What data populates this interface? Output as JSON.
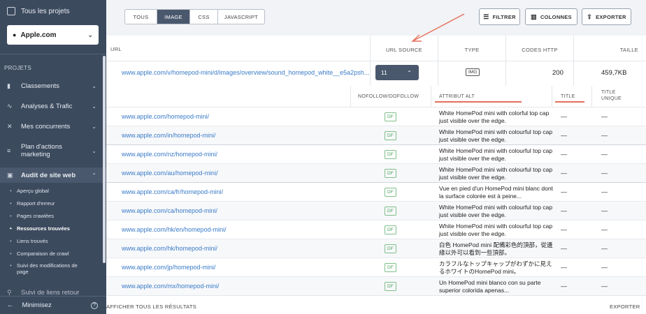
{
  "sidebar": {
    "all_projects": "Tous les projets",
    "site": "Apple.com",
    "section": "PROJETS",
    "items": [
      {
        "label": "Classements",
        "icon": "bar-chart-icon"
      },
      {
        "label": "Analyses & Trafic",
        "icon": "pulse-icon"
      },
      {
        "label": "Mes concurrents",
        "icon": "swords-icon"
      },
      {
        "label": "Plan d'actions marketing",
        "icon": "checklist-icon"
      },
      {
        "label": "Audit de site web",
        "icon": "audit-icon"
      }
    ],
    "subitems": [
      {
        "label": "Aperçu global"
      },
      {
        "label": "Rapport d'erreur"
      },
      {
        "label": "Pages crawlées"
      },
      {
        "label": "Ressources trouvées"
      },
      {
        "label": "Liens trouvés"
      },
      {
        "label": "Comparaison de crawl"
      },
      {
        "label": "Suivi des modifications de page"
      }
    ],
    "partial_item": "Suivi de liens retour",
    "minimize": "Minimisez"
  },
  "filters": {
    "tabs": [
      "TOUS",
      "IMAGE",
      "CSS",
      "JAVASCRIPT"
    ],
    "active": "IMAGE"
  },
  "toolbar": {
    "filter": "FILTRER",
    "columns": "COLONNES",
    "export": "EXPORTER"
  },
  "resources": {
    "headers": {
      "url": "URL",
      "source": "URL SOURCE",
      "type": "TYPE",
      "http": "CODES HTTP",
      "size": "TAILLE"
    },
    "row": {
      "url": "www.apple.com/v/homepod-mini/d/images/overview/sound_homepod_white__e5a2psh...",
      "source_count": "11",
      "type": "IMG",
      "http": "200",
      "size": "459,7KB"
    }
  },
  "sources": {
    "headers": {
      "nofollow": "NOFOLLOW/DOFOLLOW",
      "alt": "ATTRIBUT ALT",
      "title": "TITLE",
      "unique": "TITLE UNIQUE"
    },
    "rows": [
      {
        "url": "www.apple.com/homepod-mini/",
        "follow": "DF",
        "alt": "White HomePod mini with colorful top cap just visible over the edge.",
        "title": "—",
        "unique": "—"
      },
      {
        "url": "www.apple.com/in/homepod-mini/",
        "follow": "DF",
        "alt": "White HomePod mini with colourful top cap just visible over the edge.",
        "title": "—",
        "unique": "—"
      },
      {
        "url": "www.apple.com/nz/homepod-mini/",
        "follow": "DF",
        "alt": "White HomePod mini with colourful top cap just visible over the edge.",
        "title": "—",
        "unique": "—"
      },
      {
        "url": "www.apple.com/au/homepod-mini/",
        "follow": "DF",
        "alt": "White HomePod mini with colourful top cap just visible over the edge.",
        "title": "—",
        "unique": "—"
      },
      {
        "url": "www.apple.com/ca/fr/homepod-mini/",
        "follow": "DF",
        "alt": "Vue en pied d'un HomePod mini blanc dont la surface colorée est à peine...",
        "title": "—",
        "unique": "—"
      },
      {
        "url": "www.apple.com/ca/homepod-mini/",
        "follow": "DF",
        "alt": "White HomePod mini with colourful top cap just visible over the edge.",
        "title": "—",
        "unique": "—"
      },
      {
        "url": "www.apple.com/hk/en/homepod-mini/",
        "follow": "DF",
        "alt": "White HomePod mini with colourful top cap just visible over the edge.",
        "title": "—",
        "unique": "—"
      },
      {
        "url": "www.apple.com/hk/homepod-mini/",
        "follow": "DF",
        "alt": "白色 HomePod mini 配備彩色的頂部，從邊緣以外可以看到一些頂部。",
        "title": "—",
        "unique": "—"
      },
      {
        "url": "www.apple.com/jp/homepod-mini/",
        "follow": "DF",
        "alt": "カラフルなトップキャップがわずかに見えるホワイトのHomePod mini。",
        "title": "—",
        "unique": "—"
      },
      {
        "url": "www.apple.com/mx/homepod-mini/",
        "follow": "DF",
        "alt": "Un HomePod mini blanco con su parte superior colorida apenas...",
        "title": "—",
        "unique": "—"
      }
    ]
  },
  "footer": {
    "show_all": "AFFICHER TOUS LES RÉSULTATS",
    "export": "EXPORTER"
  },
  "colors": {
    "sidebar": "#3c4a5e",
    "accent": "#4a586d",
    "link": "#3a7bc8",
    "annotation": "#e5705a",
    "dofollow": "#4aa35a"
  }
}
